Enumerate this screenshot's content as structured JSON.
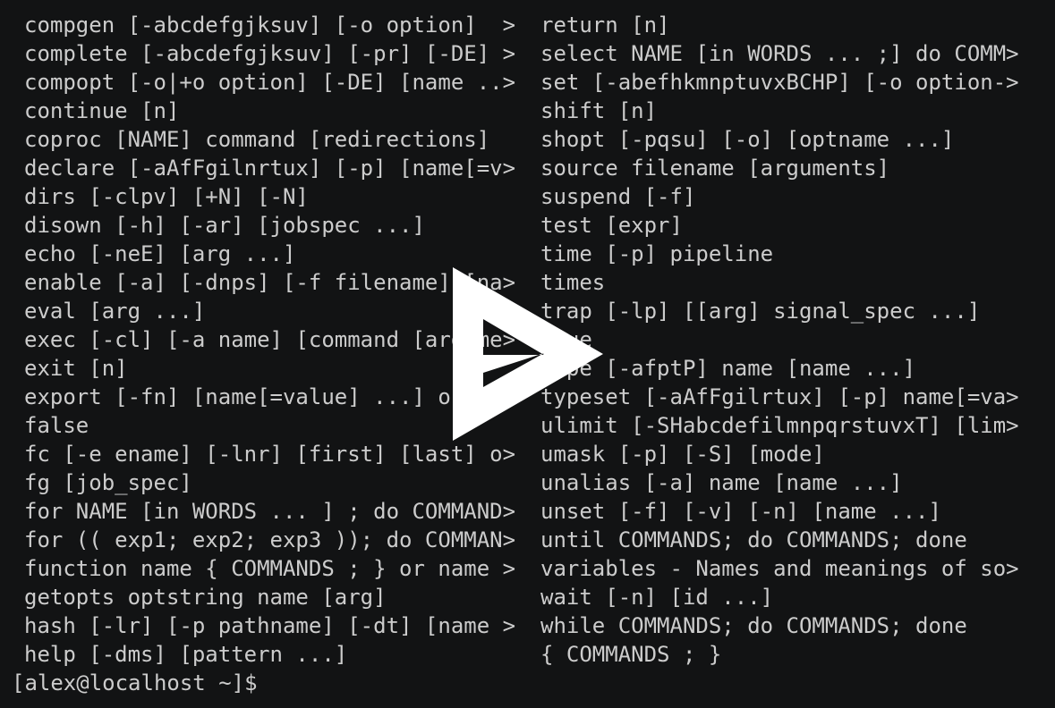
{
  "terminal": {
    "left_column": [
      "compgen [-abcdefgjksuv] [-o option]  >",
      "complete [-abcdefgjksuv] [-pr] [-DE] >",
      "compopt [-o|+o option] [-DE] [name ..>",
      "continue [n]",
      "coproc [NAME] command [redirections]",
      "declare [-aAfFgilnrtux] [-p] [name[=v>",
      "dirs [-clpv] [+N] [-N]",
      "disown [-h] [-ar] [jobspec ...]",
      "echo [-neE] [arg ...]",
      "enable [-a] [-dnps] [-f filename] [na>",
      "eval [arg ...]",
      "exec [-cl] [-a name] [command [argume>",
      "exit [n]",
      "export [-fn] [name[=value] ...] or ex>",
      "false",
      "fc [-e ename] [-lnr] [first] [last] o>",
      "fg [job_spec]",
      "for NAME [in WORDS ... ] ; do COMMAND>",
      "for (( exp1; exp2; exp3 )); do COMMAN>",
      "function name { COMMANDS ; } or name >",
      "getopts optstring name [arg]",
      "hash [-lr] [-p pathname] [-dt] [name >",
      "help [-dms] [pattern ...]"
    ],
    "right_column": [
      "return [n]",
      "select NAME [in WORDS ... ;] do COMM>",
      "set [-abefhkmnptuvxBCHP] [-o option->",
      "shift [n]",
      "shopt [-pqsu] [-o] [optname ...]",
      "source filename [arguments]",
      "suspend [-f]",
      "test [expr]",
      "time [-p] pipeline",
      "times",
      "trap [-lp] [[arg] signal_spec ...]",
      "true",
      "type [-afptP] name [name ...]",
      "typeset [-aAfFgilrtux] [-p] name[=va>",
      "ulimit [-SHabcdefilmnpqrstuvxT] [lim>",
      "umask [-p] [-S] [mode]",
      "unalias [-a] name [name ...]",
      "unset [-f] [-v] [-n] [name ...]",
      "until COMMANDS; do COMMANDS; done",
      "variables - Names and meanings of so>",
      "wait [-n] [id ...]",
      "while COMMANDS; do COMMANDS; done",
      "{ COMMANDS ; }"
    ],
    "prompt": "[alex@localhost ~]$"
  },
  "overlay": {
    "icon": "asciinema-play-icon",
    "color": "#ffffff"
  },
  "colors": {
    "background": "#121314",
    "foreground": "#cccccc"
  }
}
